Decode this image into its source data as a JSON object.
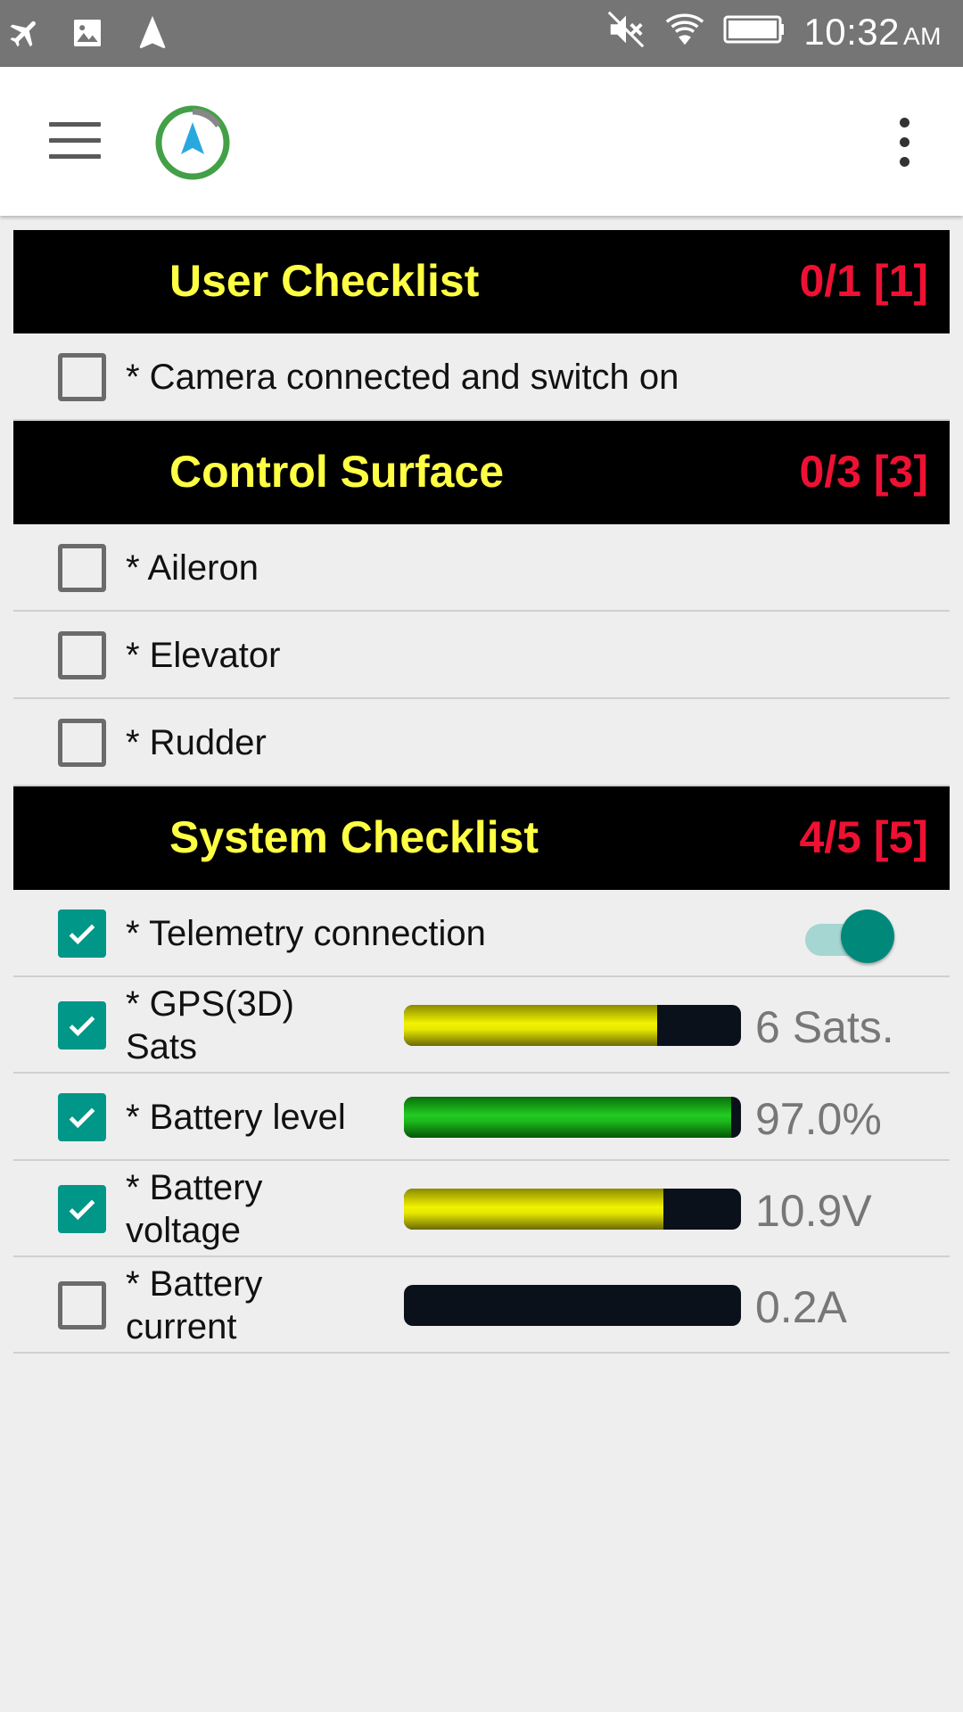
{
  "status_bar": {
    "time": "10:32",
    "ampm": "AM",
    "left_icons": [
      "airplane-icon",
      "image-icon",
      "navigation-icon"
    ],
    "right_icons": [
      "mute-icon",
      "wifi-icon",
      "battery-icon"
    ]
  },
  "app_bar": {
    "menu_icon": "hamburger-icon",
    "logo_icon": "navigation-logo-icon",
    "overflow_icon": "more-vert-icon"
  },
  "sections": [
    {
      "title": "User Checklist",
      "count": "0/1 [1]",
      "items": [
        {
          "label": "* Camera connected and switch on",
          "checked": false
        }
      ]
    },
    {
      "title": "Control Surface",
      "count": "0/3 [3]",
      "items": [
        {
          "label": "* Aileron",
          "checked": false
        },
        {
          "label": "* Elevator",
          "checked": false
        },
        {
          "label": "* Rudder",
          "checked": false
        }
      ]
    },
    {
      "title": "System Checklist",
      "count": "4/5 [5]",
      "items": [
        {
          "label": "* Telemetry connection",
          "checked": true,
          "toggle_on": true
        },
        {
          "label": "* GPS(3D) Sats",
          "checked": true,
          "bar_level": 0.75,
          "bar_color": "yellow",
          "value": "6 Sats."
        },
        {
          "label": "* Battery level",
          "checked": true,
          "bar_level": 0.97,
          "bar_color": "green",
          "value": "97.0%"
        },
        {
          "label": "* Battery voltage",
          "checked": true,
          "bar_level": 0.77,
          "bar_color": "yellow",
          "value": "10.9V"
        },
        {
          "label": "* Battery current",
          "checked": false,
          "bar_level": 0.0,
          "bar_color": "yellow",
          "value": "0.2A"
        }
      ]
    }
  ],
  "colors": {
    "header_bg": "#000000",
    "header_title": "#ffff44",
    "header_count": "#ee1133",
    "accent": "#009688",
    "bar_yellow": "#e6e600",
    "bar_green": "#1db81d"
  }
}
